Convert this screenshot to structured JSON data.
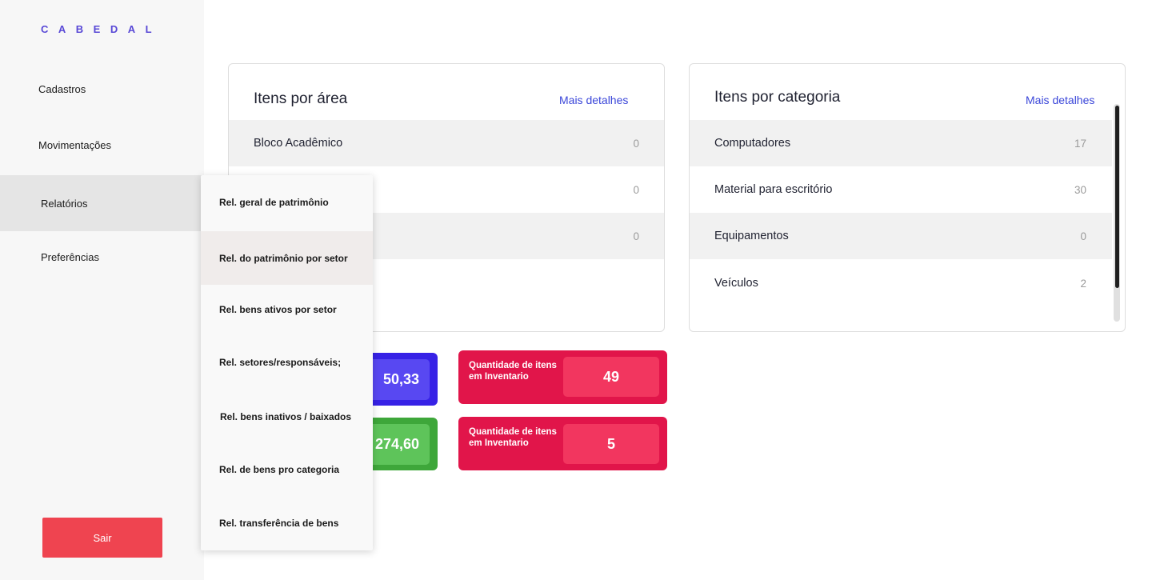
{
  "brand": "CABEDAL",
  "sidebar": {
    "items": [
      {
        "label": "Cadastros"
      },
      {
        "label": "Movimentações"
      },
      {
        "label": "Relatórios"
      },
      {
        "label": "Preferências"
      }
    ],
    "logout_label": "Sair"
  },
  "card_area": {
    "title": "Itens por área",
    "link": "Mais detalhes",
    "rows": [
      {
        "name": "Bloco Acadêmico",
        "value": "0"
      },
      {
        "name": "",
        "value": "0"
      },
      {
        "name": "",
        "value": "0"
      }
    ]
  },
  "card_category": {
    "title": "Itens por categoria",
    "link": "Mais detalhes",
    "rows": [
      {
        "name": "Computadores",
        "value": "17"
      },
      {
        "name": "Material para escritório",
        "value": "30"
      },
      {
        "name": "Equipamentos",
        "value": "0"
      },
      {
        "name": "Veículos",
        "value": "2"
      }
    ]
  },
  "tiles": {
    "blue_value": "50,33",
    "green_value": "274,60",
    "red": [
      {
        "label": "Quantidade de itens em Inventario",
        "value": "49"
      },
      {
        "label": "Quantidade de itens em Inventario",
        "value": "5"
      }
    ]
  },
  "dropdown": {
    "items": [
      {
        "label": "Rel. geral de patrimônio"
      },
      {
        "label": "Rel. do patrimônio por setor"
      },
      {
        "label": "Rel. bens ativos por setor"
      },
      {
        "label": "Rel. setores/responsáveis;"
      },
      {
        "label": "Rel. bens inativos / baixados"
      },
      {
        "label": "Rel. de bens pro categoria"
      },
      {
        "label": "Rel. transferência de bens"
      }
    ]
  },
  "colors": {
    "brand": "#5848d6",
    "accent_link": "#3a46d9",
    "logout": "#ef4450",
    "tile_blue": "#3722e6",
    "tile_green": "#3ea73a",
    "tile_red": "#e1154a"
  }
}
